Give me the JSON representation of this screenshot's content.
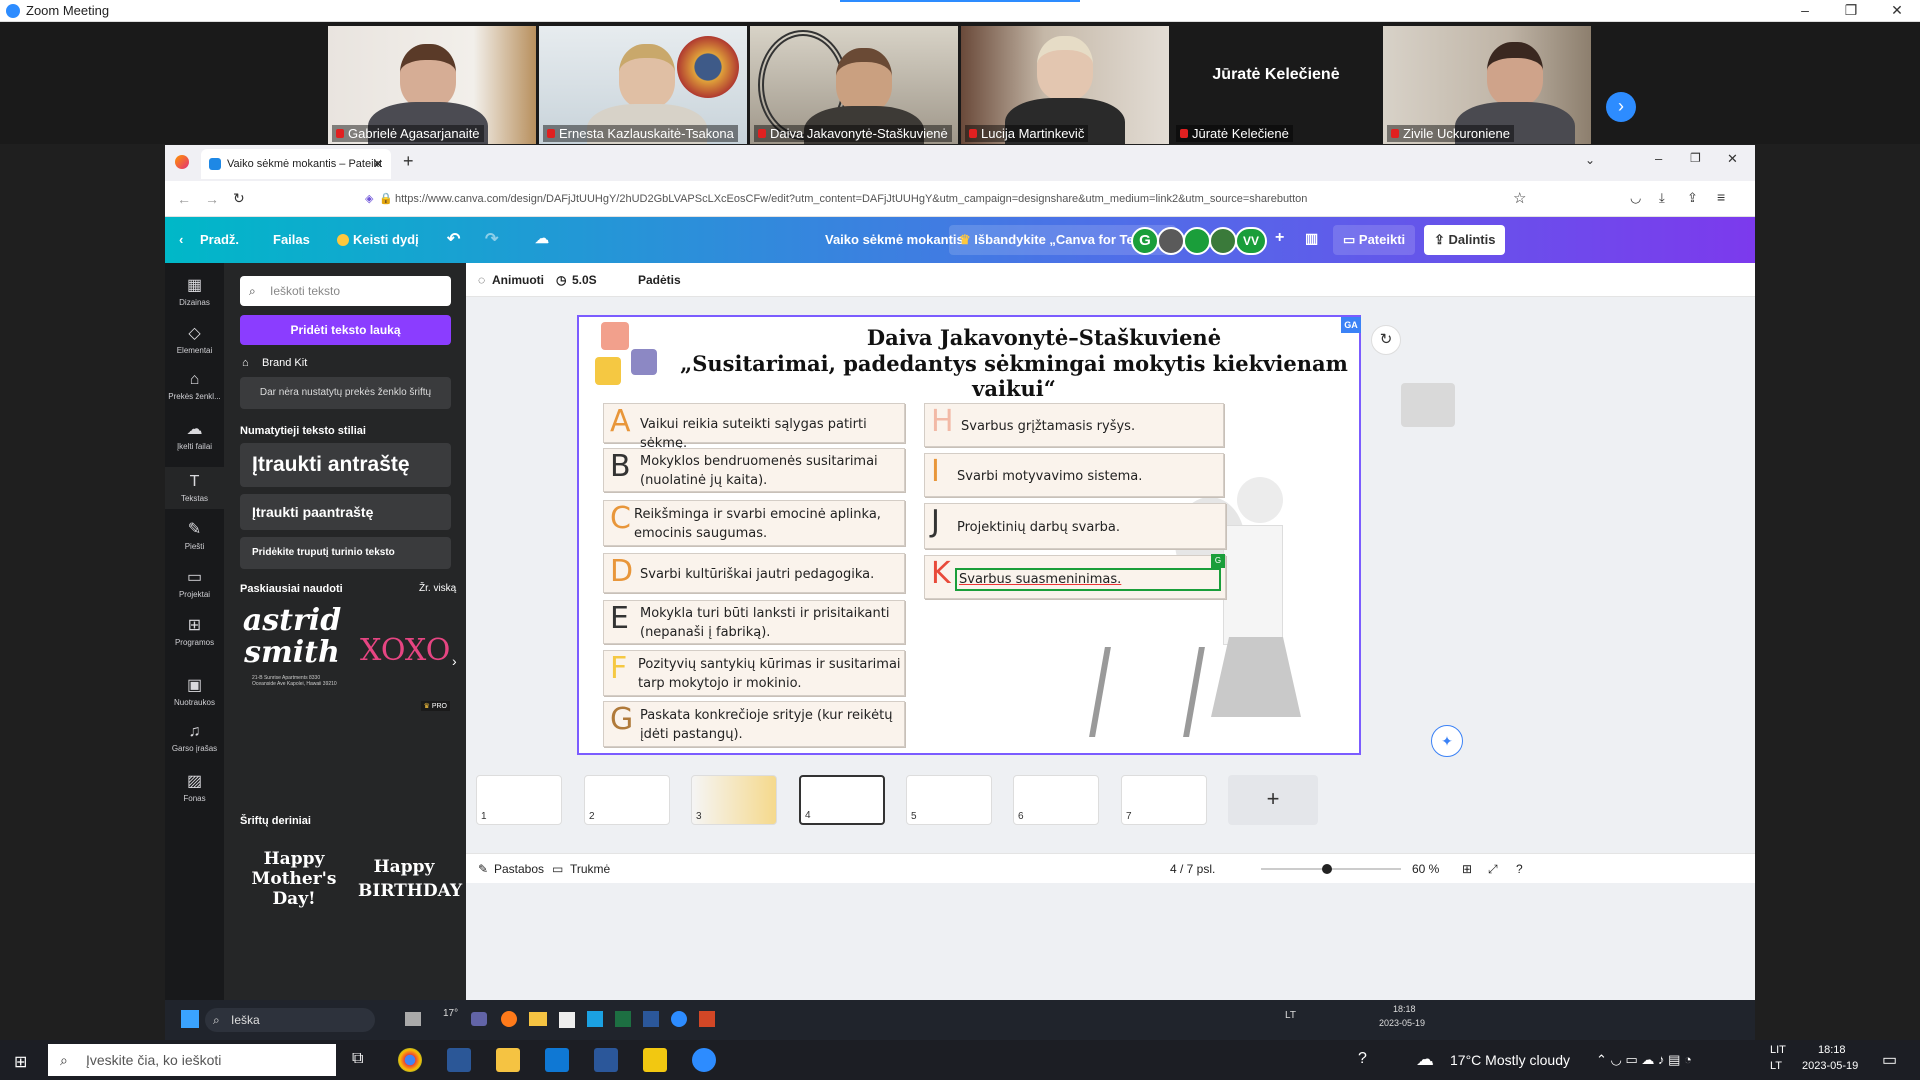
{
  "zoom": {
    "title": "Zoom Meeting",
    "window_controls": [
      "–",
      "❐",
      "✕"
    ],
    "participants": [
      {
        "name": "Gabrielė Agasarjanaitė"
      },
      {
        "name": "Ernesta Kazlauskaitė-Tsakona"
      },
      {
        "name": "Daiva Jakavonytė-Staškuvienė"
      },
      {
        "name": "Lucija Martinkevič"
      },
      {
        "name": "Jūratė Kelečienė",
        "display_name": "Jūratė Kelečienė"
      },
      {
        "name": "Zivile Uckuroniene"
      }
    ]
  },
  "browser": {
    "tab_title": "Vaiko sėkmė mokantis – Pateikt",
    "url": "https://www.canva.com/design/DAFjJtUUHgY/2hUD2GbLVAPScLXcEosCFw/edit?utm_content=DAFjJtUUHgY&utm_campaign=designshare&utm_medium=link2&utm_source=sharebutton"
  },
  "canva": {
    "header": {
      "home": "Pradž.",
      "file": "Failas",
      "resize": "Keisti dydį",
      "doc_title": "Vaiko sėkmė mokantis",
      "teams_promo": "Išbandykite „Canva for Teams“",
      "avatars": [
        "G",
        "VV"
      ],
      "present": "Pateikti",
      "share": "Dalintis"
    },
    "rail": [
      {
        "label": "Dizainas",
        "icon": "▦"
      },
      {
        "label": "Elementai",
        "icon": "◇"
      },
      {
        "label": "Prekės ženkl...",
        "icon": "⌂"
      },
      {
        "label": "Įkelti failai",
        "icon": "☁"
      },
      {
        "label": "Tekstas",
        "icon": "T"
      },
      {
        "label": "Piešti",
        "icon": "✎"
      },
      {
        "label": "Projektai",
        "icon": "▭"
      },
      {
        "label": "Programos",
        "icon": "⊞"
      },
      {
        "label": "Nuotraukos",
        "icon": "▣"
      },
      {
        "label": "Garso įrašas",
        "icon": "♫"
      },
      {
        "label": "Fonas",
        "icon": "▨"
      }
    ],
    "panel": {
      "search_placeholder": "Ieškoti teksto",
      "add_text_button": "Pridėti teksto lauką",
      "brand_kit": "Brand Kit",
      "brand_kit_empty": "Dar nėra nustatytų prekės ženklo šriftų",
      "default_styles_heading": "Numatytieji teksto stiliai",
      "heading_style": "Įtraukti antraštę",
      "subheading_style": "Įtraukti paantraštę",
      "body_style": "Pridėkite truputį turinio teksto",
      "recent_heading": "Paskiausiai naudoti",
      "see_all": "Žr. viską",
      "recent_1": "astrid smith",
      "recent_1_small": "21-B Sunrise Apartments 8330 Oceanside Ave Kapolei, Hawaii 39210",
      "recent_2": "XOXO",
      "pro_badge": "PRO",
      "combos_heading": "Šriftų deriniai",
      "combo_1": "Happy Mother's Day!",
      "combo_2": "Happy BIRTHDAY"
    },
    "toolbar": {
      "animate": "Animuoti",
      "duration": "5.0S",
      "position": "Padėtis"
    },
    "slide": {
      "author": "Daiva Jakavonytė–Staškuvienė",
      "title": "„Susitarimai, padedantys sėkmingai mokytis kiekvienam vaikui“",
      "badge": "GA",
      "items_left": [
        {
          "letter": "A",
          "text": "Vaikui reikia suteikti sąlygas patirti sėkmę."
        },
        {
          "letter": "B",
          "text": "Mokyklos bendruomenės susitarimai (nuolatinė jų kaita)."
        },
        {
          "letter": "C",
          "text": "Reikšminga ir svarbi emocinė aplinka, emocinis saugumas."
        },
        {
          "letter": "D",
          "text": "Svarbi kultūriškai jautri pedagogika."
        },
        {
          "letter": "E",
          "text": "Mokykla turi būti lanksti ir prisitaikanti (nepanaši į fabriką)."
        },
        {
          "letter": "F",
          "text": "Pozityvių santykių kūrimas ir susitarimai tarp mokytojo ir mokinio."
        },
        {
          "letter": "G",
          "text": "Paskata konkrečioje srityje (kur reikėtų įdėti pastangų)."
        }
      ],
      "items_right": [
        {
          "letter": "H",
          "text": "Svarbus grįžtamasis ryšys."
        },
        {
          "letter": "I",
          "text": "Svarbi motyvavimo sistema."
        },
        {
          "letter": "J",
          "text": "Projektinių darbų svarba."
        },
        {
          "letter": "K",
          "text": "Svarbus suasmeninimas."
        }
      ],
      "editing_badge": "G"
    },
    "filmstrip": {
      "pages": [
        "1",
        "2",
        "3",
        "4",
        "5",
        "6",
        "7"
      ],
      "add": "+"
    },
    "bottom": {
      "notes": "Pastabos",
      "duration": "Trukmė",
      "page_indicator": "4 / 7 psl.",
      "zoom": "60 %"
    }
  },
  "remote_taskbar": {
    "search": "Ieška",
    "temp": "17°",
    "time": "18:18",
    "date": "2023-05-19",
    "lang": "LT"
  },
  "taskbar": {
    "search_placeholder": "Įveskite čia, ko ieškoti",
    "weather": "17°C  Mostly cloudy",
    "lang_top": "LIT",
    "lang_bottom": "LT",
    "time": "18:18",
    "date": "2023-05-19"
  }
}
